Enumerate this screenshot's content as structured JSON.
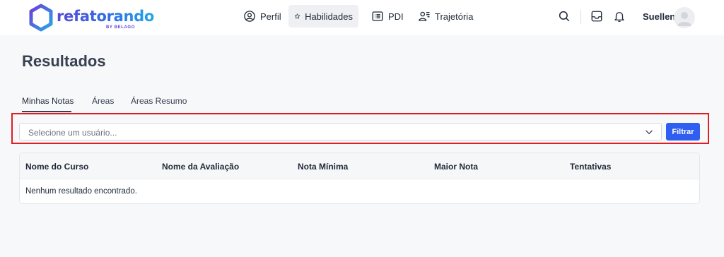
{
  "brand": {
    "name": "refatorando",
    "tagline": "BY BELAGO",
    "gradient_start": "#5a47d6",
    "gradient_end": "#26a6e8"
  },
  "nav": [
    {
      "label": "Perfil",
      "icon": "user-circle-icon",
      "active": false
    },
    {
      "label": "Habilidades",
      "icon": "star-icon",
      "active": true
    },
    {
      "label": "PDI",
      "icon": "list-icon",
      "active": false
    },
    {
      "label": "Trajetória",
      "icon": "user-list-icon",
      "active": false
    }
  ],
  "header_icons": [
    "search-icon",
    "inbox-icon",
    "bell-icon"
  ],
  "user": {
    "name": "Suellen",
    "avatar_icon": "user-avatar-icon"
  },
  "page": {
    "title": "Resultados"
  },
  "tabs": [
    {
      "label": "Minhas Notas",
      "active": true
    },
    {
      "label": "Áreas",
      "active": false
    },
    {
      "label": "Áreas Resumo",
      "active": false
    }
  ],
  "filter": {
    "placeholder": "Selecione um usuário...",
    "button_label": "Filtrar",
    "button_color": "#2f5ff0",
    "highlight_color": "#e11d22"
  },
  "table": {
    "columns": [
      "Nome do Curso",
      "Nome da Avaliação",
      "Nota Mínima",
      "Maior Nota",
      "Tentativas"
    ],
    "empty_message": "Nenhum resultado encontrado."
  }
}
